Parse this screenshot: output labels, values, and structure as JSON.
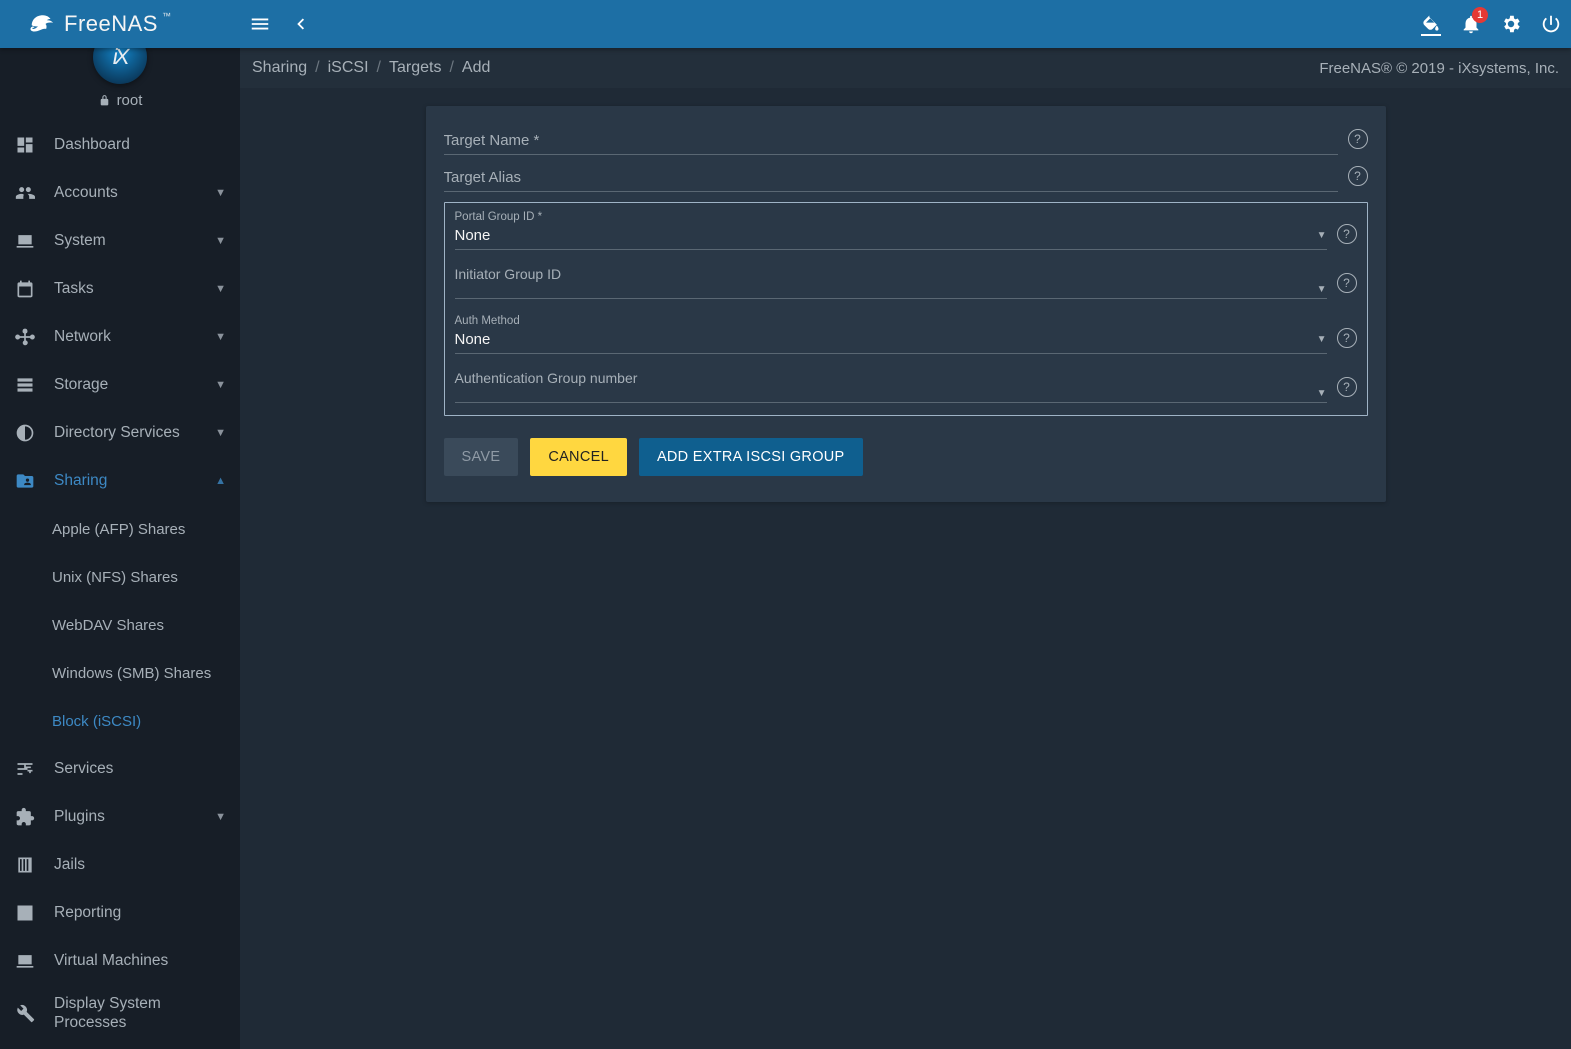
{
  "brand": {
    "name": "FreeNAS",
    "tm": "™"
  },
  "topbar": {
    "menu_icon": "menu",
    "collapse_icon": "chevron-left",
    "notification_count": "1"
  },
  "user": {
    "icon": "lock",
    "name": "root",
    "avatar_text": "iX"
  },
  "breadcrumbs": [
    "Sharing",
    "iSCSI",
    "Targets",
    "Add"
  ],
  "copyright": "FreeNAS® © 2019 - iXsystems, Inc.",
  "sidebar": {
    "items": [
      {
        "label": "Dashboard",
        "icon": "dashboard",
        "expandable": false
      },
      {
        "label": "Accounts",
        "icon": "accounts",
        "expandable": true
      },
      {
        "label": "System",
        "icon": "system",
        "expandable": true
      },
      {
        "label": "Tasks",
        "icon": "tasks",
        "expandable": true
      },
      {
        "label": "Network",
        "icon": "network",
        "expandable": true
      },
      {
        "label": "Storage",
        "icon": "storage",
        "expandable": true
      },
      {
        "label": "Directory Services",
        "icon": "directory",
        "expandable": true
      },
      {
        "label": "Sharing",
        "icon": "sharing",
        "expandable": true,
        "active": true,
        "expanded": true
      },
      {
        "label": "Services",
        "icon": "services",
        "expandable": false
      },
      {
        "label": "Plugins",
        "icon": "plugins",
        "expandable": true
      },
      {
        "label": "Jails",
        "icon": "jails",
        "expandable": false
      },
      {
        "label": "Reporting",
        "icon": "reporting",
        "expandable": false
      },
      {
        "label": "Virtual Machines",
        "icon": "vm",
        "expandable": false
      },
      {
        "label": "Display System Processes",
        "icon": "processes",
        "expandable": false
      }
    ],
    "sharing_children": [
      {
        "label": "Apple (AFP) Shares"
      },
      {
        "label": "Unix (NFS) Shares"
      },
      {
        "label": "WebDAV Shares"
      },
      {
        "label": "Windows (SMB) Shares"
      },
      {
        "label": "Block (iSCSI)",
        "current": true
      }
    ]
  },
  "form": {
    "target_name": {
      "label": "Target Name *",
      "value": ""
    },
    "target_alias": {
      "label": "Target Alias",
      "value": ""
    },
    "portal_group": {
      "label": "Portal Group ID *",
      "value": "None"
    },
    "initiator_group": {
      "label": "Initiator Group ID",
      "value": ""
    },
    "auth_method": {
      "label": "Auth Method",
      "value": "None"
    },
    "auth_group": {
      "label": "Authentication Group number",
      "value": ""
    }
  },
  "buttons": {
    "save": "SAVE",
    "cancel": "CANCEL",
    "add_group": "ADD EXTRA ISCSI GROUP"
  }
}
